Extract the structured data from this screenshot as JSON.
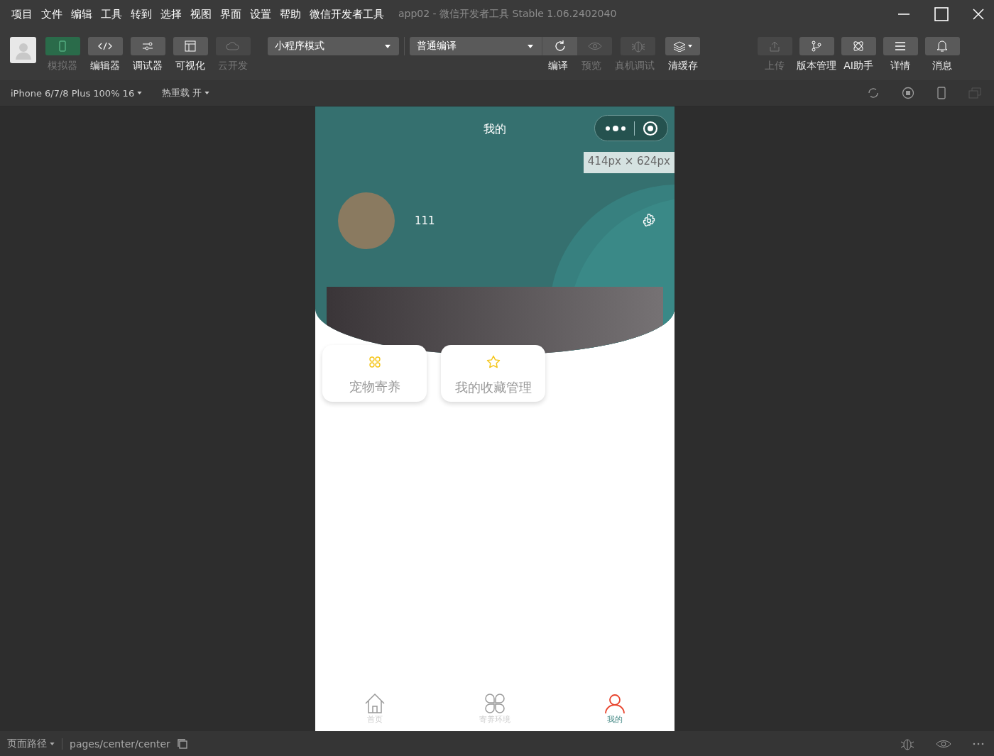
{
  "menu": [
    "项目",
    "文件",
    "编辑",
    "工具",
    "转到",
    "选择",
    "视图",
    "界面",
    "设置",
    "帮助",
    "微信开发者工具"
  ],
  "window": {
    "title": "app02 - 微信开发者工具 Stable 1.06.2402040"
  },
  "toolbar": {
    "left": [
      {
        "label": "模拟器",
        "selected": true,
        "disabled": true
      },
      {
        "label": "编辑器",
        "selected": false,
        "disabled": false
      },
      {
        "label": "调试器",
        "selected": false,
        "disabled": false
      },
      {
        "label": "可视化",
        "selected": false,
        "disabled": false
      },
      {
        "label": "云开发",
        "selected": false,
        "disabled": true
      }
    ],
    "mode_select": "小程序模式",
    "compile_select": "普通编译",
    "middle": [
      {
        "label": "编译",
        "disabled": false
      },
      {
        "label": "预览",
        "disabled": true
      },
      {
        "label": "真机调试",
        "disabled": true
      },
      {
        "label": "清缓存",
        "disabled": false
      }
    ],
    "right": [
      {
        "label": "上传",
        "disabled": true
      },
      {
        "label": "版本管理",
        "disabled": false
      },
      {
        "label": "AI助手",
        "disabled": false
      },
      {
        "label": "详情",
        "disabled": false
      },
      {
        "label": "消息",
        "disabled": false
      }
    ]
  },
  "sim_bar": {
    "device": "iPhone 6/7/8 Plus 100% 16",
    "hot_reload": "热重载 开"
  },
  "phone": {
    "nav_title": "我的",
    "size_tip": "414px × 624px",
    "user_name": "111",
    "features": [
      {
        "label": "宠物寄养"
      },
      {
        "label": "我的收藏管理"
      }
    ],
    "tabs": [
      {
        "label": "首页",
        "selected": false
      },
      {
        "label": "寄养环境",
        "selected": false
      },
      {
        "label": "我的",
        "selected": true
      }
    ]
  },
  "status_bar": {
    "path_label": "页面路径",
    "path": "pages/center/center"
  }
}
